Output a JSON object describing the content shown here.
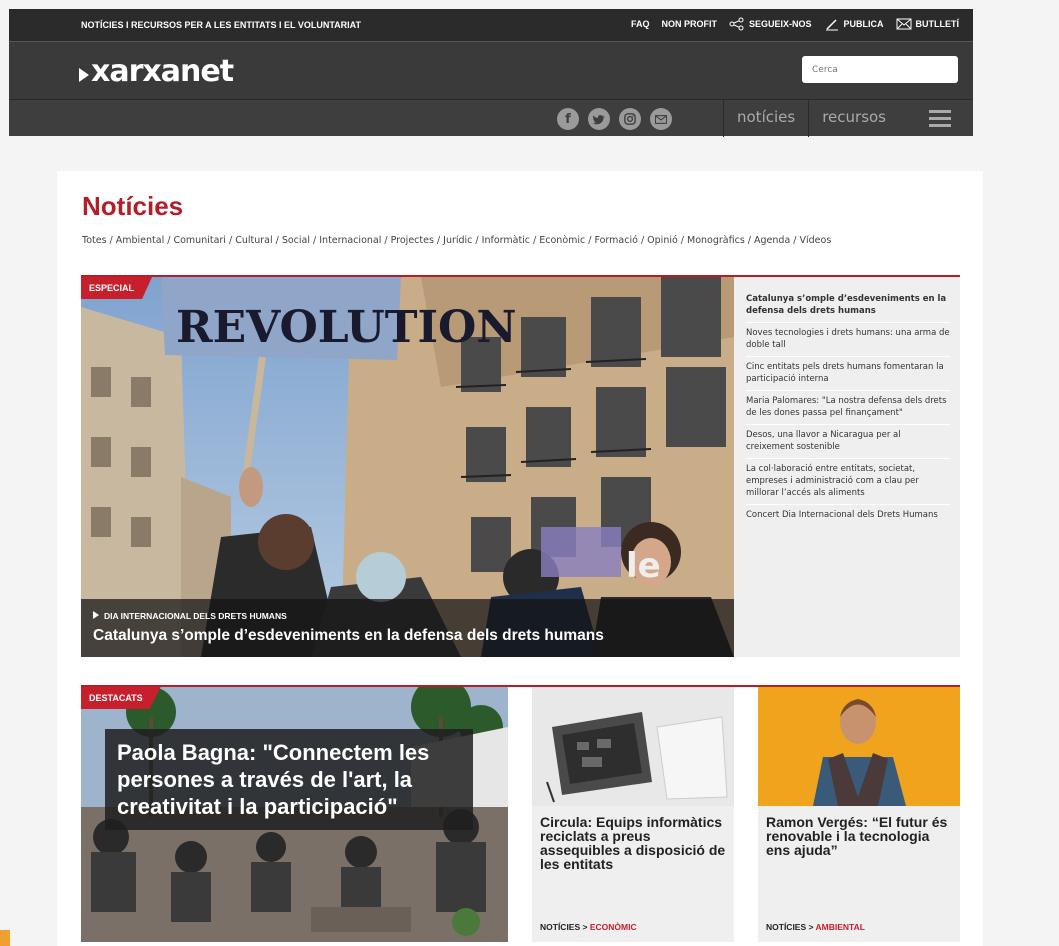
{
  "topbar": {
    "tagline": "NOTÍCIES I RECURSOS PER A LES ENTITATS I EL VOLUNTARIAT",
    "links": [
      "FAQ",
      "NON PROFIT",
      "SEGUEIX-NOS",
      "PUBLICA",
      "BUTLLETÍ"
    ]
  },
  "header": {
    "logo": "xarxanet",
    "search_placeholder": "Cerca"
  },
  "nav": {
    "social_icons": [
      "facebook-icon",
      "twitter-icon",
      "instagram-icon",
      "mail-icon"
    ],
    "links": [
      "notícies",
      "recursos"
    ]
  },
  "page": {
    "title": "Notícies",
    "categories": "Totes / Ambiental / Comunitari / Cultural / Social / Internacional / Projectes / Jurídic / Informàtic / Econòmic / Formació / Opinió / Monogràfics / Agenda / Vídeos"
  },
  "featured": {
    "tag": "ESPECIAL",
    "kicker": "DIA INTERNACIONAL DELS DRETS HUMANS",
    "title": "Catalunya s’omple d’esdeveniments en la defensa dels drets humans",
    "sign_text": "REVOLUTION",
    "side_items": [
      "Catalunya s’omple d’esdeveniments en la defensa dels drets humans",
      "Noves tecnologies i drets humans: una arma de doble tall",
      "Cinc entitats pels drets humans fomentaran la participació interna",
      "Maria Palomares: \"La nostra defensa dels drets de les dones passa pel finançament\"",
      "Desos, una llavor a Nicaragua per al creixement sostenible",
      "La col·laboració entre entitats, societat, empreses i administració com a clau per millorar l’accés als aliments",
      "Concert Dia Internacional dels Drets Humans"
    ]
  },
  "destacats": {
    "tag": "DESTACATS",
    "title": "Paola Bagna: \"Connectem les persones a través de l'art, la creativitat i la participació\"",
    "cards": [
      {
        "title": "Circula: Equips informàtics reciclats a preus assequibles a disposició de les entitats",
        "section": "NOTÍCIES",
        "category": "ECONÒMIC"
      },
      {
        "title": "Ramon Vergés: “El futur és renovable i la tecnologia ens ajuda”",
        "section": "NOTÍCIES",
        "category": "AMBIENTAL"
      }
    ]
  }
}
